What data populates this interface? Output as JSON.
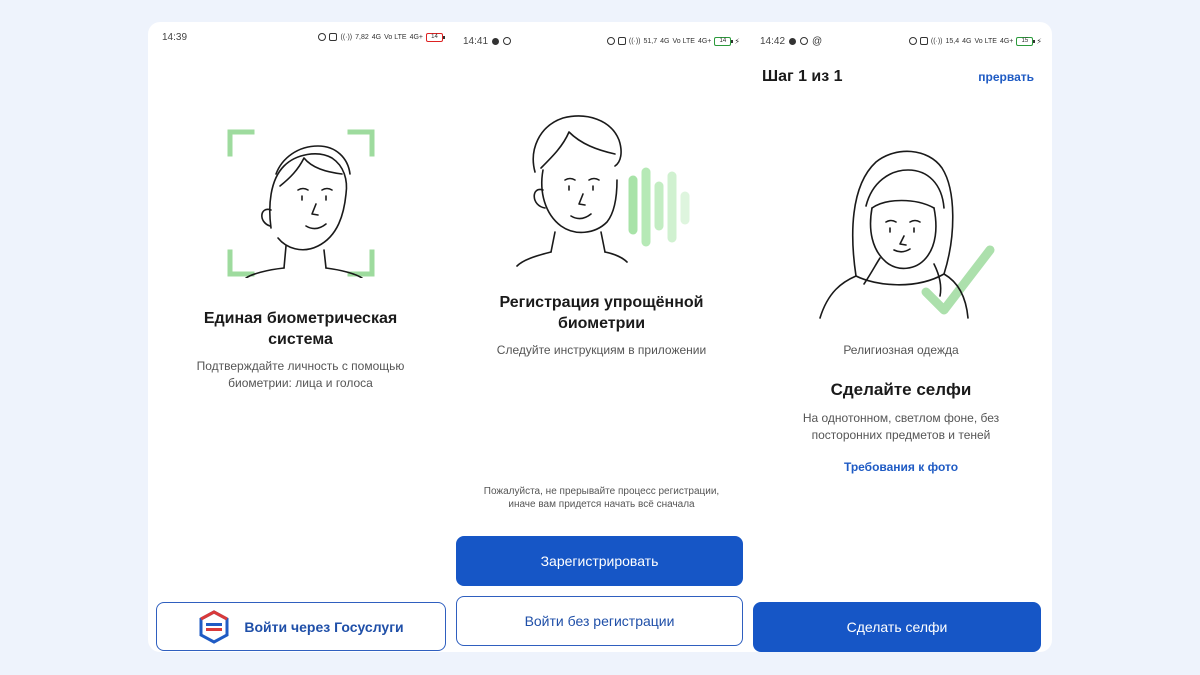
{
  "screen1": {
    "status": {
      "time": "14:39",
      "speed": "7,82",
      "network": "4G",
      "volte": "Vo LTE",
      "network2": "4G+",
      "battery": "14"
    },
    "title": "Единая биометрическая система",
    "subtitle": "Подтверждайте личность с помощью биометрии: лица и голоса",
    "gosuslugi_button": "Войти через Госуслуги"
  },
  "screen2": {
    "status": {
      "time": "14:41",
      "speed": "51,7",
      "network": "4G",
      "volte": "Vo LTE",
      "network2": "4G+",
      "battery": "14"
    },
    "title": "Регистрация упрощённой биометрии",
    "subtitle": "Следуйте инструкциям в приложении",
    "warning": "Пожалуйста, не прерывайте процесс регистрации, иначе вам придется начать всё сначала",
    "register_button": "Зарегистрировать",
    "login_no_reg_button": "Войти без регистрации"
  },
  "screen3": {
    "status": {
      "time": "14:42",
      "speed": "15,4",
      "network": "4G",
      "volte": "Vo LTE",
      "network2": "4G+",
      "battery": "15"
    },
    "step": "Шаг 1 из 1",
    "abort": "прервать",
    "caption": "Религиозная одежда",
    "title": "Сделайте селфи",
    "subtitle": "На однотонном, светлом фоне, без посторонних предметов и теней",
    "requirements_link": "Требования к фото",
    "selfie_button": "Сделать селфи"
  },
  "colors": {
    "primary": "#1656c6",
    "link": "#1f5bc4",
    "accent_green": "#8fdc8f",
    "background": "#eef3fc"
  }
}
